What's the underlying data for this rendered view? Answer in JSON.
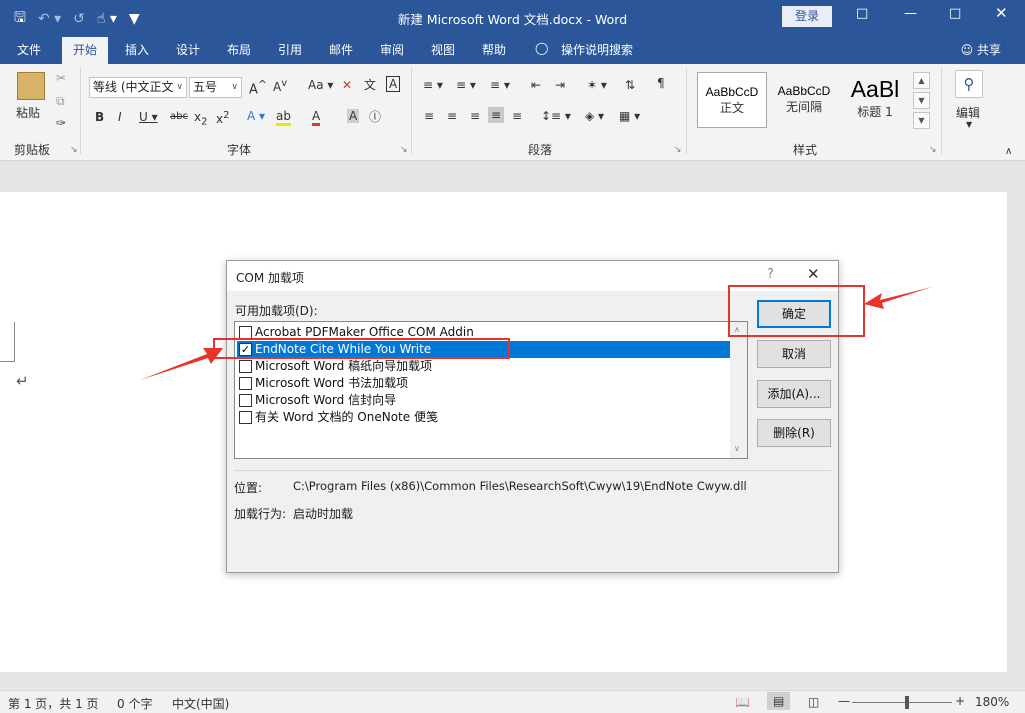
{
  "window": {
    "title": "新建 Microsoft Word 文档.docx - Word",
    "login": "登录"
  },
  "tabs": {
    "file": "文件",
    "home": "开始",
    "insert": "插入",
    "design": "设计",
    "layout": "布局",
    "references": "引用",
    "mailings": "邮件",
    "review": "审阅",
    "view": "视图",
    "help": "帮助",
    "tell_me": "操作说明搜索",
    "share": "共享"
  },
  "ribbon": {
    "clipboard": {
      "label": "剪贴板",
      "paste": "粘贴"
    },
    "font": {
      "label": "字体",
      "font_name": "等线 (中文正文",
      "font_size": "五号"
    },
    "paragraph": {
      "label": "段落"
    },
    "styles": {
      "label": "样式",
      "items": [
        {
          "sample": "AaBbCcD",
          "name": "正文"
        },
        {
          "sample": "AaBbCcD",
          "name": "无间隔"
        },
        {
          "sample": "AaBl",
          "name": "标题 1"
        }
      ]
    },
    "editing": {
      "label": "编辑"
    }
  },
  "dialog": {
    "title": "COM 加载项",
    "help": "?",
    "available_label": "可用加载项(D):",
    "addins": [
      {
        "name": "Acrobat PDFMaker Office COM Addin",
        "checked": false,
        "selected": false
      },
      {
        "name": "EndNote Cite While You Write",
        "checked": true,
        "selected": true
      },
      {
        "name": "Microsoft Word 稿纸向导加载项",
        "checked": false,
        "selected": false
      },
      {
        "name": "Microsoft Word 书法加载项",
        "checked": false,
        "selected": false
      },
      {
        "name": "Microsoft Word 信封向导",
        "checked": false,
        "selected": false
      },
      {
        "name": "有关 Word 文档的 OneNote 便笺",
        "checked": false,
        "selected": false
      }
    ],
    "buttons": {
      "ok": "确定",
      "cancel": "取消",
      "add": "添加(A)...",
      "remove": "删除(R)"
    },
    "location_label": "位置:",
    "location_value": "C:\\Program Files (x86)\\Common Files\\ResearchSoft\\Cwyw\\19\\EndNote Cwyw.dll",
    "load_behavior_label": "加载行为:",
    "load_behavior_value": "启动时加载"
  },
  "status": {
    "page": "第 1 页，共 1 页",
    "words": "0 个字",
    "language": "中文(中国)",
    "zoom": "180%",
    "zoom_level_fraction": 0.55
  },
  "colors": {
    "word_blue": "#2b579a",
    "selection": "#0078d7",
    "annotation_red": "#e8322b"
  },
  "icons": [
    "save-icon",
    "undo-icon",
    "redo-icon",
    "touch-mode-icon",
    "customize-qat-icon",
    "lightbulb-icon",
    "user-icon",
    "paste-icon",
    "cut-icon",
    "copy-icon",
    "format-painter-icon",
    "search-icon",
    "check-icon",
    "arrow-icon"
  ]
}
